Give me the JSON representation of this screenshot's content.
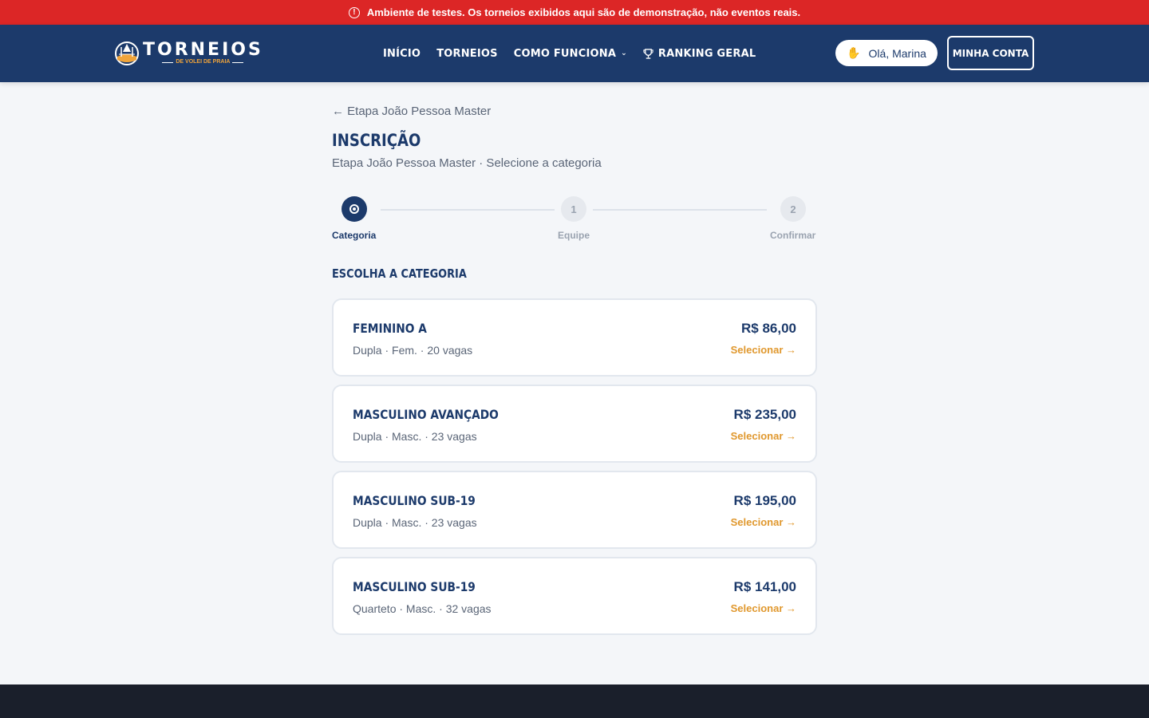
{
  "alert": {
    "icon": "alert-circle-icon",
    "text": "Ambiente de testes. Os torneios exibidos aqui são de demonstração, não eventos reais."
  },
  "brand": {
    "title": "TORNEIOS",
    "subtitle": "DE VOLEI DE PRAIA"
  },
  "nav": {
    "items": [
      {
        "label": "INÍCIO"
      },
      {
        "label": "TORNEIOS"
      },
      {
        "label": "COMO FUNCIONA"
      },
      {
        "label": "RANKING GERAL"
      }
    ]
  },
  "user": {
    "greeting": "Olá, Marina",
    "account_label": "MINHA CONTA"
  },
  "page": {
    "back_label": "← Etapa João Pessoa Master",
    "title": "INSCRIÇÃO",
    "subtitle": "Etapa João Pessoa Master · Selecione a categoria"
  },
  "stepper": {
    "steps": [
      {
        "label": "Categoria",
        "marker": "",
        "state": "active"
      },
      {
        "label": "Equipe",
        "marker": "1",
        "state": "inactive"
      },
      {
        "label": "Confirmar",
        "marker": "2",
        "state": "inactive"
      }
    ]
  },
  "section": {
    "title": "ESCOLHA A CATEGORIA"
  },
  "categories": [
    {
      "name": "FEMININO A",
      "meta": "Dupla · Fem. · 20 vagas",
      "price": "R$ 86,00",
      "action": "Selecionar →"
    },
    {
      "name": "MASCULINO AVANÇADO",
      "meta": "Dupla · Masc. · 23 vagas",
      "price": "R$ 235,00",
      "action": "Selecionar →"
    },
    {
      "name": "MASCULINO SUB-19",
      "meta": "Dupla · Masc. · 23 vagas",
      "price": "R$ 195,00",
      "action": "Selecionar →"
    },
    {
      "name": "MASCULINO SUB-19",
      "meta": "Quarteto · Masc. · 32 vagas",
      "price": "R$ 141,00",
      "action": "Selecionar →"
    }
  ],
  "colors": {
    "alert": "#dc2626",
    "navy": "#1c3a6b",
    "accent": "#e0982e",
    "footer": "#1a1f2b"
  }
}
